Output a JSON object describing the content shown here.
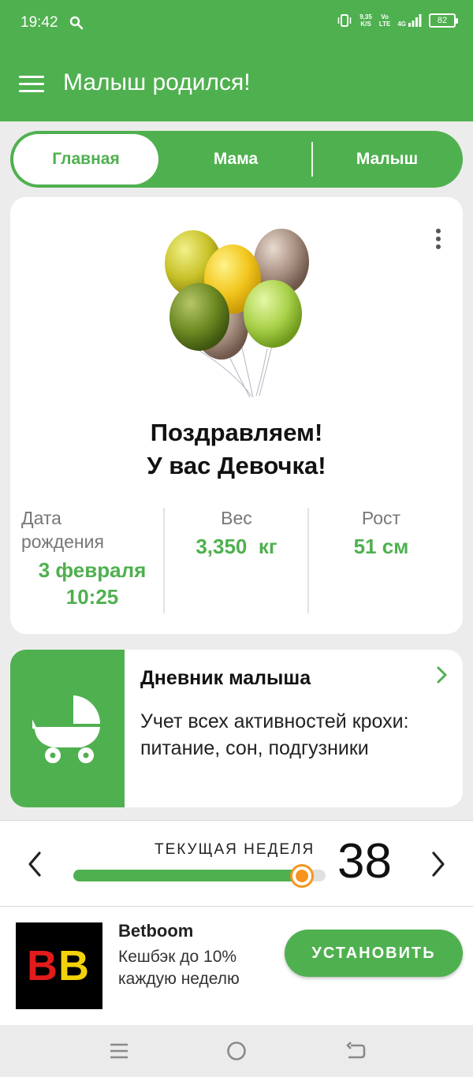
{
  "status_bar": {
    "time": "19:42",
    "speed_value": "9,35",
    "speed_unit": "K/S",
    "volte_top": "Vo",
    "volte_bottom": "LTE",
    "network": "4G",
    "battery": "82"
  },
  "app_bar": {
    "title": "Малыш родился!"
  },
  "tabs": [
    {
      "label": "Главная",
      "active": true
    },
    {
      "label": "Мама",
      "active": false
    },
    {
      "label": "Малыш",
      "active": false
    }
  ],
  "birth_card": {
    "congrats_line1": "Поздравляем!",
    "congrats_line2": "У вас Девочка!",
    "birth_date_label_1": "Дата",
    "birth_date_label_2": "рождения",
    "birth_date_value": "3 февраля",
    "birth_time_value": "10:25",
    "weight_label": "Вес",
    "weight_value": "3,350  кг",
    "height_label": "Рост",
    "height_value": "51 см"
  },
  "diary_card": {
    "title": "Дневник малыша",
    "description": "Учет всех активностей крохи: питание, сон, подгузники"
  },
  "week_bar": {
    "label": "ТЕКУЩАЯ НЕДЕЛЯ",
    "week": "38",
    "progress_fraction": 0.905
  },
  "ad": {
    "logo_text": "BB",
    "name": "Betboom",
    "description": "Кешбэк до 10% каждую неделю",
    "button_label": "УСТАНОВИТЬ"
  },
  "colors": {
    "primary_green": "#4fb04f",
    "slider_thumb": "#f7941d",
    "background": "#ececec"
  },
  "icons": [
    "search-icon",
    "vibrate-icon",
    "signal-icon",
    "battery-icon",
    "menu-icon",
    "more-vert-icon",
    "balloons-image",
    "stroller-icon",
    "chevron-right-icon",
    "chevron-left-icon",
    "recents-icon",
    "home-icon",
    "back-icon"
  ]
}
